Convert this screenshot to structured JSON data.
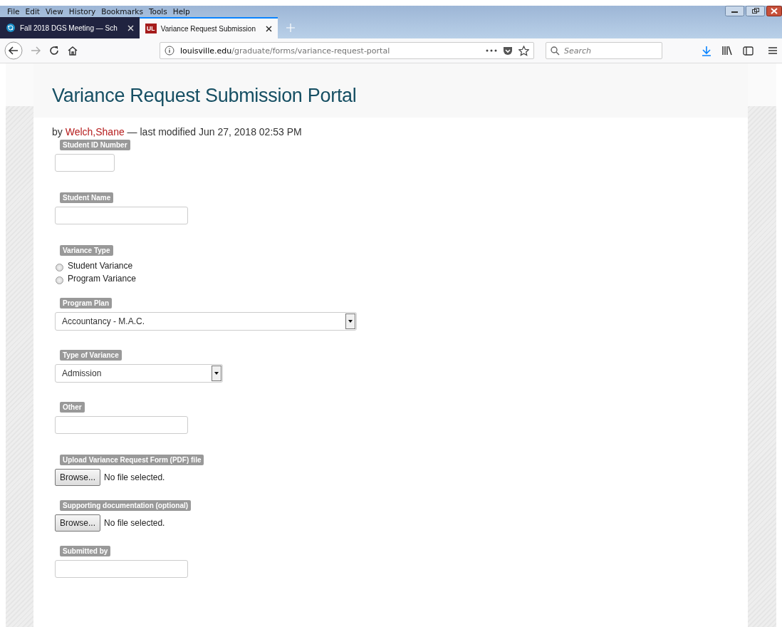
{
  "menu_bar": [
    "File",
    "Edit",
    "View",
    "History",
    "Bookmarks",
    "Tools",
    "Help"
  ],
  "tabs": [
    {
      "label": "Fall 2018 DGS Meeting — Sch",
      "selected": false
    },
    {
      "label": "Variance Request Submission",
      "selected": true,
      "icon_text": "UL"
    }
  ],
  "address_bar": {
    "host": "louisville.edu",
    "path": "/graduate/forms/variance-request-portal"
  },
  "search": {
    "placeholder": "Search"
  },
  "page": {
    "title": "Variance Request Submission Portal",
    "byline": {
      "prefix": "by",
      "author": "Welch,Shane",
      "suffix": "— last modified Jun 27, 2018 02:53 PM"
    },
    "fields": [
      {
        "kind": "text",
        "label": "Student ID Number"
      },
      {
        "kind": "text",
        "label": "Student Name"
      },
      {
        "kind": "radio",
        "label": "Variance Type",
        "options": [
          {
            "label": "Student Variance",
            "selected": false
          },
          {
            "label": "Program Variance",
            "selected": false
          }
        ]
      },
      {
        "kind": "select",
        "label": "Program Plan",
        "value": "Accountancy - M.A.C."
      },
      {
        "kind": "select",
        "label": "Type of Variance",
        "value": "Admission"
      },
      {
        "kind": "text",
        "label": "Other"
      },
      {
        "kind": "file",
        "label": "Upload Variance Request Form (PDF) file",
        "button": "Browse...",
        "status": "No file selected."
      },
      {
        "kind": "file",
        "label": "Supporting documentation (optional)",
        "button": "Browse...",
        "status": "No file selected."
      },
      {
        "kind": "text",
        "label": "Submitted by"
      }
    ]
  }
}
